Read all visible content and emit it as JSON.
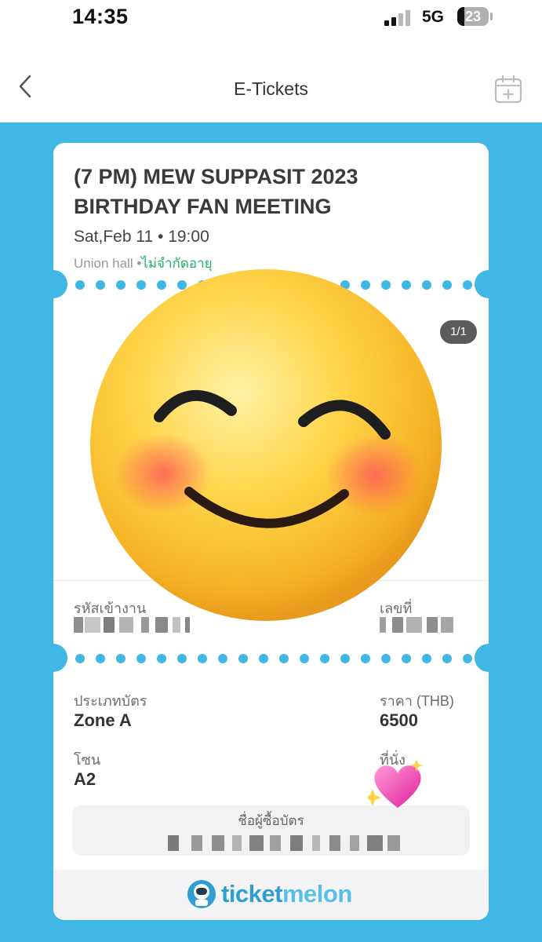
{
  "status_bar": {
    "time": "14:35",
    "network": "5G",
    "battery": "23",
    "battery_level": 0.23
  },
  "header": {
    "title": "E-Tickets",
    "back_icon": "chevron-left-icon",
    "action_icon": "calendar-add-icon"
  },
  "event": {
    "title_line1": "(7 PM) MEW SUPPASIT 2023",
    "title_line2": "BIRTHDAY FAN MEETING",
    "date_time": "Sat,Feb 11 • 19:00",
    "venue": "Union hall •",
    "age_restriction": "ไม่จำกัดอายุ"
  },
  "ticket": {
    "page_indicator": "1/1",
    "entry_code_label": "รหัสเข้างาน",
    "number_label": "เลขที่",
    "ticket_type_label": "ประเภทบัตร",
    "ticket_type": "Zone A",
    "price_label": "ราคา (THB)",
    "price": "6500",
    "zone_label": "โซน",
    "zone": "A2",
    "seat_label": "ที่นั่ง",
    "buyer_label": "ชื่อผู้ซื้อบัตร"
  },
  "footer": {
    "brand_prefix": "ticket",
    "brand_suffix": "melon"
  },
  "overlays": [
    "smiling-face-emoji",
    "sparkling-heart-emoji"
  ],
  "colors": {
    "background": "#40b7e4",
    "brand": "#2f9fcf",
    "age_tag": "#20b26b"
  }
}
